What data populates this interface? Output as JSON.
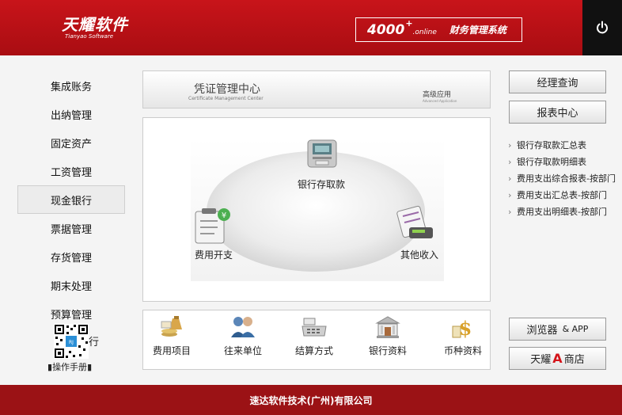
{
  "header": {
    "logo_cn": "天耀软件",
    "logo_en": "Tianyao Software",
    "hotline_number": "4000",
    "hotline_plus": "+",
    "hotline_suffix": ".online",
    "system_title": "财务管理系统"
  },
  "sidebar": {
    "items": [
      {
        "label": "集成账务"
      },
      {
        "label": "出纳管理"
      },
      {
        "label": "固定资产"
      },
      {
        "label": "工资管理"
      },
      {
        "label": "现金银行"
      },
      {
        "label": "票据管理"
      },
      {
        "label": "存货管理"
      },
      {
        "label": "期末处理"
      },
      {
        "label": "预算管理"
      }
    ],
    "qr_side_text": "行",
    "manual_label": "操作手册"
  },
  "voucher_center": {
    "title": "凭证管理中心",
    "subtitle": "Certificate Management Center",
    "advanced": "高级应用",
    "advanced_sub": "Advanced Application"
  },
  "flow": {
    "bank": "银行存取款",
    "expense": "费用开支",
    "other_income": "其他收入"
  },
  "tiles": [
    {
      "label": "费用项目"
    },
    {
      "label": "往来单位"
    },
    {
      "label": "结算方式"
    },
    {
      "label": "银行资料"
    },
    {
      "label": "币种资料"
    }
  ],
  "right": {
    "query_button": "经理查询",
    "report_button": "报表中心",
    "browser_button": "浏览器",
    "browser_app": "& APP",
    "store_prefix": "天耀",
    "store_letter": "A",
    "store_suffix": "商店"
  },
  "reports": [
    {
      "label": "银行存取款汇总表"
    },
    {
      "label": "银行存取款明细表"
    },
    {
      "label": "费用支出综合报表-按部门"
    },
    {
      "label": "费用支出汇总表-按部门"
    },
    {
      "label": "费用支出明细表-按部门"
    }
  ],
  "footer": {
    "company": "速达软件技术(广州)有限公司"
  },
  "colors": {
    "brand_red": "#c8141a",
    "footer_red": "#9b1215",
    "store_red": "#d4141a"
  }
}
